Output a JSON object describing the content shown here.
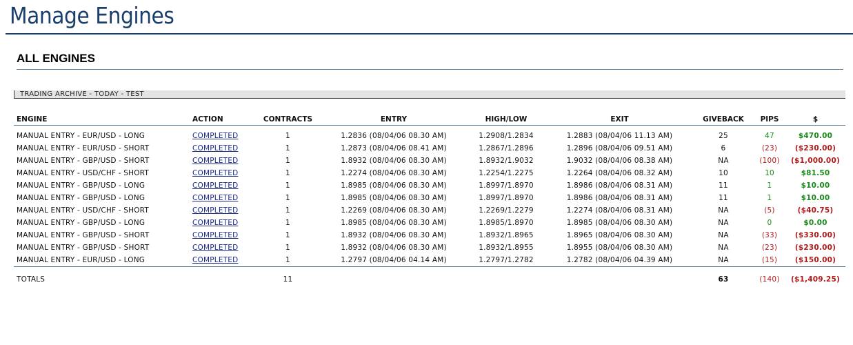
{
  "page": {
    "title": "Manage Engines"
  },
  "section": {
    "title": "ALL ENGINES"
  },
  "archive_bar": {
    "label": "TRADING ARCHIVE - TODAY - TEST"
  },
  "colors": {
    "positive": "#1a8a1a",
    "negative": "#b01a1a",
    "link": "#1a2a8c",
    "accent": "#1a3f6b"
  },
  "table": {
    "headers": {
      "engine": "ENGINE",
      "action": "ACTION",
      "contracts": "CONTRACTS",
      "entry": "ENTRY",
      "highlow": "HIGH/LOW",
      "exit": "EXIT",
      "giveback": "GIVEBACK",
      "pips": "PIPS",
      "dollars": "$"
    },
    "rows": [
      {
        "engine": "MANUAL ENTRY - EUR/USD - LONG",
        "action": "COMPLETED",
        "contracts": "1",
        "entry": "1.2836 (08/04/06 08.30 AM)",
        "highlow": "1.2908/1.2834",
        "exit": "1.2883 (08/04/06 11.13 AM)",
        "giveback": "25",
        "pips": "47",
        "dollars": "$470.00",
        "sign": "pos"
      },
      {
        "engine": "MANUAL ENTRY - EUR/USD - SHORT",
        "action": "COMPLETED",
        "contracts": "1",
        "entry": "1.2873 (08/04/06 08.41 AM)",
        "highlow": "1.2867/1.2896",
        "exit": "1.2896 (08/04/06 09.51 AM)",
        "giveback": "6",
        "pips": "(23)",
        "dollars": "($230.00)",
        "sign": "neg"
      },
      {
        "engine": "MANUAL ENTRY - GBP/USD - SHORT",
        "action": "COMPLETED",
        "contracts": "1",
        "entry": "1.8932 (08/04/06 08.30 AM)",
        "highlow": "1.8932/1.9032",
        "exit": "1.9032 (08/04/06 08.38 AM)",
        "giveback": "NA",
        "pips": "(100)",
        "dollars": "($1,000.00)",
        "sign": "neg"
      },
      {
        "engine": "MANUAL ENTRY - USD/CHF - SHORT",
        "action": "COMPLETED",
        "contracts": "1",
        "entry": "1.2274 (08/04/06 08.30 AM)",
        "highlow": "1.2254/1.2275",
        "exit": "1.2264 (08/04/06 08.32 AM)",
        "giveback": "10",
        "pips": "10",
        "dollars": "$81.50",
        "sign": "pos"
      },
      {
        "engine": "MANUAL ENTRY - GBP/USD - LONG",
        "action": "COMPLETED",
        "contracts": "1",
        "entry": "1.8985 (08/04/06 08.30 AM)",
        "highlow": "1.8997/1.8970",
        "exit": "1.8986 (08/04/06 08.31 AM)",
        "giveback": "11",
        "pips": "1",
        "dollars": "$10.00",
        "sign": "pos"
      },
      {
        "engine": "MANUAL ENTRY - GBP/USD - LONG",
        "action": "COMPLETED",
        "contracts": "1",
        "entry": "1.8985 (08/04/06 08.30 AM)",
        "highlow": "1.8997/1.8970",
        "exit": "1.8986 (08/04/06 08.31 AM)",
        "giveback": "11",
        "pips": "1",
        "dollars": "$10.00",
        "sign": "pos"
      },
      {
        "engine": "MANUAL ENTRY - USD/CHF - SHORT",
        "action": "COMPLETED",
        "contracts": "1",
        "entry": "1.2269 (08/04/06 08.30 AM)",
        "highlow": "1.2269/1.2279",
        "exit": "1.2274 (08/04/06 08.31 AM)",
        "giveback": "NA",
        "pips": "(5)",
        "dollars": "($40.75)",
        "sign": "neg"
      },
      {
        "engine": "MANUAL ENTRY - GBP/USD - LONG",
        "action": "COMPLETED",
        "contracts": "1",
        "entry": "1.8985 (08/04/06 08.30 AM)",
        "highlow": "1.8985/1.8970",
        "exit": "1.8985 (08/04/06 08.30 AM)",
        "giveback": "NA",
        "pips": "0",
        "dollars": "$0.00",
        "sign": "pos"
      },
      {
        "engine": "MANUAL ENTRY - GBP/USD - SHORT",
        "action": "COMPLETED",
        "contracts": "1",
        "entry": "1.8932 (08/04/06 08.30 AM)",
        "highlow": "1.8932/1.8965",
        "exit": "1.8965 (08/04/06 08.30 AM)",
        "giveback": "NA",
        "pips": "(33)",
        "dollars": "($330.00)",
        "sign": "neg"
      },
      {
        "engine": "MANUAL ENTRY - GBP/USD - SHORT",
        "action": "COMPLETED",
        "contracts": "1",
        "entry": "1.8932 (08/04/06 08.30 AM)",
        "highlow": "1.8932/1.8955",
        "exit": "1.8955 (08/04/06 08.30 AM)",
        "giveback": "NA",
        "pips": "(23)",
        "dollars": "($230.00)",
        "sign": "neg"
      },
      {
        "engine": "MANUAL ENTRY - EUR/USD - LONG",
        "action": "COMPLETED",
        "contracts": "1",
        "entry": "1.2797 (08/04/06 04.14 AM)",
        "highlow": "1.2797/1.2782",
        "exit": "1.2782 (08/04/06 04.39 AM)",
        "giveback": "NA",
        "pips": "(15)",
        "dollars": "($150.00)",
        "sign": "neg"
      }
    ],
    "totals": {
      "label": "TOTALS",
      "contracts": "11",
      "giveback": "63",
      "pips": "(140)",
      "dollars": "($1,409.25)"
    }
  }
}
